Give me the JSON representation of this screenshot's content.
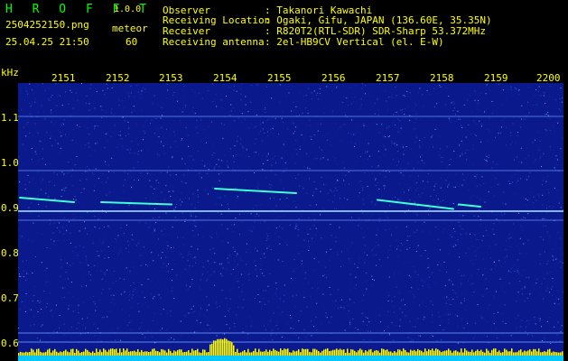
{
  "header": {
    "logo": "H R O F F T",
    "version": "1.0.0",
    "filename": "2504252150.png",
    "datetime": "25.04.25 21:50",
    "type_label": "meteor",
    "count": "60",
    "fields": [
      {
        "label": "Observer",
        "value": ": Takanori Kawachi"
      },
      {
        "label": "Receiving Location",
        "value": ": Ogaki, Gifu, JAPAN (136.60E, 35.35N)"
      },
      {
        "label": "Receiver",
        "value": ": R820T2(RTL-SDR) SDR-Sharp 53.372MHz"
      },
      {
        "label": "Receiving antenna",
        "value": ": 2el-HB9CV Vertical (el. E-W)"
      }
    ]
  },
  "axes": {
    "y_unit": "kHz",
    "time_ticks": [
      "2151",
      "2152",
      "2153",
      "2154",
      "2155",
      "2156",
      "2157",
      "2158",
      "2159",
      "2200"
    ],
    "freq_ticks": [
      "1.1",
      "1.0",
      "0.9",
      "0.8",
      "0.7",
      "0.6"
    ]
  },
  "colors": {
    "label": "#ffff00",
    "logo": "#00ff00",
    "background_noise": "#0a1a8c",
    "trace": "#40ffd0",
    "signal_bar": "#ffff00",
    "baseline": "#00c8ff"
  },
  "chart_data": {
    "type": "heatmap",
    "x_range_minutes": [
      "21:50",
      "22:00"
    ],
    "y_range_khz": [
      0.58,
      1.18
    ],
    "reference_lines_khz": [
      1.1,
      0.98,
      0.89,
      0.87,
      0.62,
      0.6
    ],
    "meteor_traces": [
      {
        "t_start": "21:53.6",
        "t_end": "21:55.1",
        "f_start_khz": 0.94,
        "f_end_khz": 0.93
      },
      {
        "t_start": "21:50.0",
        "t_end": "21:51.0",
        "f_start_khz": 0.92,
        "f_end_khz": 0.91
      },
      {
        "t_start": "21:51.5",
        "t_end": "21:52.8",
        "f_start_khz": 0.91,
        "f_end_khz": 0.905
      },
      {
        "t_start": "21:56.6",
        "t_end": "21:58.0",
        "f_start_khz": 0.915,
        "f_end_khz": 0.895
      },
      {
        "t_start": "21:58.1",
        "t_end": "21:58.5",
        "f_start_khz": 0.905,
        "f_end_khz": 0.9
      }
    ]
  }
}
